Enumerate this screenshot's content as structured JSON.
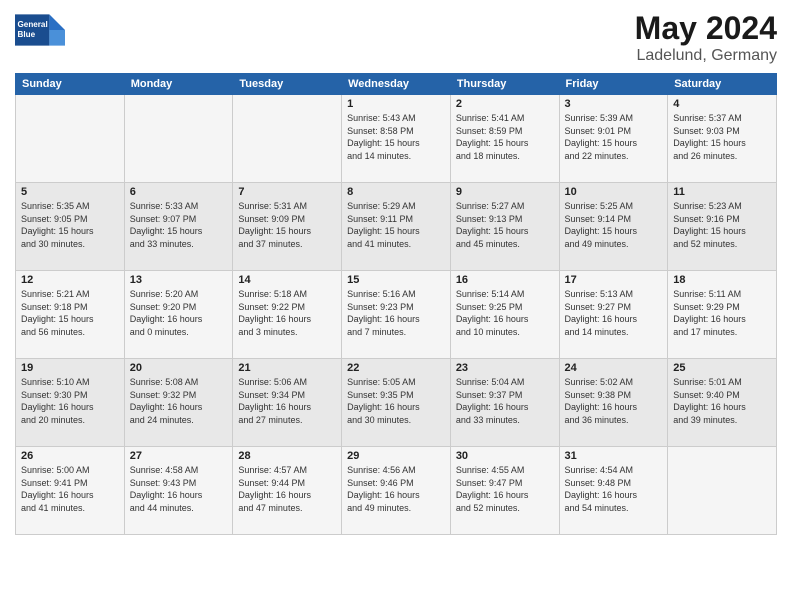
{
  "header": {
    "logo_line1": "General",
    "logo_line2": "Blue",
    "title": "May 2024",
    "location": "Ladelund, Germany"
  },
  "days_of_week": [
    "Sunday",
    "Monday",
    "Tuesday",
    "Wednesday",
    "Thursday",
    "Friday",
    "Saturday"
  ],
  "weeks": [
    [
      {
        "day": "",
        "info": ""
      },
      {
        "day": "",
        "info": ""
      },
      {
        "day": "",
        "info": ""
      },
      {
        "day": "1",
        "info": "Sunrise: 5:43 AM\nSunset: 8:58 PM\nDaylight: 15 hours\nand 14 minutes."
      },
      {
        "day": "2",
        "info": "Sunrise: 5:41 AM\nSunset: 8:59 PM\nDaylight: 15 hours\nand 18 minutes."
      },
      {
        "day": "3",
        "info": "Sunrise: 5:39 AM\nSunset: 9:01 PM\nDaylight: 15 hours\nand 22 minutes."
      },
      {
        "day": "4",
        "info": "Sunrise: 5:37 AM\nSunset: 9:03 PM\nDaylight: 15 hours\nand 26 minutes."
      }
    ],
    [
      {
        "day": "5",
        "info": "Sunrise: 5:35 AM\nSunset: 9:05 PM\nDaylight: 15 hours\nand 30 minutes."
      },
      {
        "day": "6",
        "info": "Sunrise: 5:33 AM\nSunset: 9:07 PM\nDaylight: 15 hours\nand 33 minutes."
      },
      {
        "day": "7",
        "info": "Sunrise: 5:31 AM\nSunset: 9:09 PM\nDaylight: 15 hours\nand 37 minutes."
      },
      {
        "day": "8",
        "info": "Sunrise: 5:29 AM\nSunset: 9:11 PM\nDaylight: 15 hours\nand 41 minutes."
      },
      {
        "day": "9",
        "info": "Sunrise: 5:27 AM\nSunset: 9:13 PM\nDaylight: 15 hours\nand 45 minutes."
      },
      {
        "day": "10",
        "info": "Sunrise: 5:25 AM\nSunset: 9:14 PM\nDaylight: 15 hours\nand 49 minutes."
      },
      {
        "day": "11",
        "info": "Sunrise: 5:23 AM\nSunset: 9:16 PM\nDaylight: 15 hours\nand 52 minutes."
      }
    ],
    [
      {
        "day": "12",
        "info": "Sunrise: 5:21 AM\nSunset: 9:18 PM\nDaylight: 15 hours\nand 56 minutes."
      },
      {
        "day": "13",
        "info": "Sunrise: 5:20 AM\nSunset: 9:20 PM\nDaylight: 16 hours\nand 0 minutes."
      },
      {
        "day": "14",
        "info": "Sunrise: 5:18 AM\nSunset: 9:22 PM\nDaylight: 16 hours\nand 3 minutes."
      },
      {
        "day": "15",
        "info": "Sunrise: 5:16 AM\nSunset: 9:23 PM\nDaylight: 16 hours\nand 7 minutes."
      },
      {
        "day": "16",
        "info": "Sunrise: 5:14 AM\nSunset: 9:25 PM\nDaylight: 16 hours\nand 10 minutes."
      },
      {
        "day": "17",
        "info": "Sunrise: 5:13 AM\nSunset: 9:27 PM\nDaylight: 16 hours\nand 14 minutes."
      },
      {
        "day": "18",
        "info": "Sunrise: 5:11 AM\nSunset: 9:29 PM\nDaylight: 16 hours\nand 17 minutes."
      }
    ],
    [
      {
        "day": "19",
        "info": "Sunrise: 5:10 AM\nSunset: 9:30 PM\nDaylight: 16 hours\nand 20 minutes."
      },
      {
        "day": "20",
        "info": "Sunrise: 5:08 AM\nSunset: 9:32 PM\nDaylight: 16 hours\nand 24 minutes."
      },
      {
        "day": "21",
        "info": "Sunrise: 5:06 AM\nSunset: 9:34 PM\nDaylight: 16 hours\nand 27 minutes."
      },
      {
        "day": "22",
        "info": "Sunrise: 5:05 AM\nSunset: 9:35 PM\nDaylight: 16 hours\nand 30 minutes."
      },
      {
        "day": "23",
        "info": "Sunrise: 5:04 AM\nSunset: 9:37 PM\nDaylight: 16 hours\nand 33 minutes."
      },
      {
        "day": "24",
        "info": "Sunrise: 5:02 AM\nSunset: 9:38 PM\nDaylight: 16 hours\nand 36 minutes."
      },
      {
        "day": "25",
        "info": "Sunrise: 5:01 AM\nSunset: 9:40 PM\nDaylight: 16 hours\nand 39 minutes."
      }
    ],
    [
      {
        "day": "26",
        "info": "Sunrise: 5:00 AM\nSunset: 9:41 PM\nDaylight: 16 hours\nand 41 minutes."
      },
      {
        "day": "27",
        "info": "Sunrise: 4:58 AM\nSunset: 9:43 PM\nDaylight: 16 hours\nand 44 minutes."
      },
      {
        "day": "28",
        "info": "Sunrise: 4:57 AM\nSunset: 9:44 PM\nDaylight: 16 hours\nand 47 minutes."
      },
      {
        "day": "29",
        "info": "Sunrise: 4:56 AM\nSunset: 9:46 PM\nDaylight: 16 hours\nand 49 minutes."
      },
      {
        "day": "30",
        "info": "Sunrise: 4:55 AM\nSunset: 9:47 PM\nDaylight: 16 hours\nand 52 minutes."
      },
      {
        "day": "31",
        "info": "Sunrise: 4:54 AM\nSunset: 9:48 PM\nDaylight: 16 hours\nand 54 minutes."
      },
      {
        "day": "",
        "info": ""
      }
    ]
  ]
}
